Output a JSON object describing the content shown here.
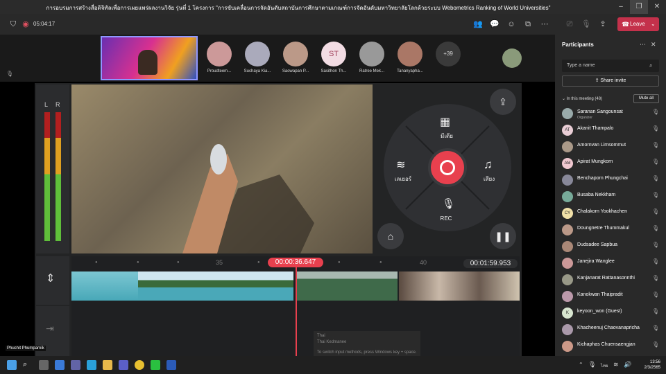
{
  "window": {
    "title": "การอบรมการสร้างสื่อดิจิทัลเพื่อการเผยแพร่ผลงานวิจัย รุ่นที่ 1 โครงการ \"การขับเคลื่อนการจัดอันดับสถาบันการศึกษาตามเกณฑ์การจัดอันดับมหาวิทยาลัยโลกด้วยระบบ Webometrics Ranking of World Universities\""
  },
  "meeting": {
    "timer": "05:04:17",
    "leave_label": "Leave"
  },
  "strip": {
    "participants": [
      {
        "name": "Proudteem...",
        "initials": ""
      },
      {
        "name": "Suchaya Kia...",
        "initials": ""
      },
      {
        "name": "Saowapan P...",
        "initials": ""
      },
      {
        "name": "Sasithon Th...",
        "initials": "ST"
      },
      {
        "name": "Ratree Mek...",
        "initials": ""
      },
      {
        "name": "Tananyapha...",
        "initials": ""
      }
    ],
    "more_count": "+39"
  },
  "presenter": {
    "name": "Phuchit Phumparnik"
  },
  "editor": {
    "meter_labels": [
      "L",
      "R"
    ],
    "dial": {
      "media_label": "มีเดีย",
      "layer_label": "เลเยอร์",
      "audio_label": "เสียง",
      "rec_label": "REC"
    },
    "ruler_ticks": [
      "35",
      "40"
    ],
    "current_time": "00:00:36.647",
    "total_time": "00:01:59.953"
  },
  "ime": {
    "line1": "Thai",
    "line2": "Thai Kedmanee",
    "line3": "To switch input methods, press Windows key + space."
  },
  "panel": {
    "title": "Participants",
    "search_placeholder": "Type a name",
    "share_invite": "Share invite",
    "in_meeting": "In this meeting (48)",
    "mute_all": "Mute all",
    "people": [
      {
        "name": "Saranan Sangounsat",
        "role": "Organizer",
        "initials": ""
      },
      {
        "name": "Akanit Thampalo",
        "role": "",
        "initials": "AT"
      },
      {
        "name": "Amornvan Limsommut",
        "role": "",
        "initials": ""
      },
      {
        "name": "Apirat Mungkorn",
        "role": "",
        "initials": "AM"
      },
      {
        "name": "Benchaporn Phungchai",
        "role": "",
        "initials": ""
      },
      {
        "name": "Busaba Nekkham",
        "role": "",
        "initials": ""
      },
      {
        "name": "Chalakorn Yookhachen",
        "role": "",
        "initials": "CY"
      },
      {
        "name": "Doungnetre Thummakul",
        "role": "",
        "initials": ""
      },
      {
        "name": "Dudsadee Sapbua",
        "role": "",
        "initials": ""
      },
      {
        "name": "Janejira Wanglee",
        "role": "",
        "initials": ""
      },
      {
        "name": "Kanjanarat Rattanasonnthi",
        "role": "",
        "initials": ""
      },
      {
        "name": "Kanokwan Thaipradit",
        "role": "",
        "initials": ""
      },
      {
        "name": "keyoon_won (Guest)",
        "role": "",
        "initials": "K"
      },
      {
        "name": "Khacheenuj Chaovanapricha",
        "role": "",
        "initials": ""
      },
      {
        "name": "Kichaphas Chuensaengjan",
        "role": "",
        "initials": ""
      }
    ]
  },
  "taskbar": {
    "time": "13:56",
    "date": "2/3/2565"
  },
  "colors": {
    "accent": "#e8404e",
    "leave": "#c4314b"
  }
}
